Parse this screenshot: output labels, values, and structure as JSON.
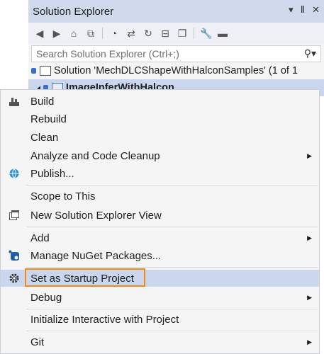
{
  "explorer": {
    "title": "Solution Explorer",
    "title_buttons": [
      "▾",
      "Ⅱ",
      "✕"
    ],
    "search_placeholder": "Search Solution Explorer (Ctrl+;)",
    "search_icon": "search-icon",
    "solution_label": "Solution 'MechDLCShapeWithHalconSamples' (1 of 1",
    "project_label": "ImageInferWithHalcon"
  },
  "menu": {
    "build": "Build",
    "rebuild": "Rebuild",
    "clean": "Clean",
    "analyze": "Analyze and Code Cleanup",
    "publish": "Publish...",
    "scope": "Scope to This",
    "new_view": "New Solution Explorer View",
    "add": "Add",
    "nuget": "Manage NuGet Packages...",
    "startup": "Set as Startup Project",
    "debug": "Debug",
    "interactive": "Initialize Interactive with Project",
    "git": "Git"
  },
  "colors": {
    "highlight": "#c9d6ee",
    "startup_outline": "#f28a12",
    "title_bar": "#cfd9eb"
  }
}
